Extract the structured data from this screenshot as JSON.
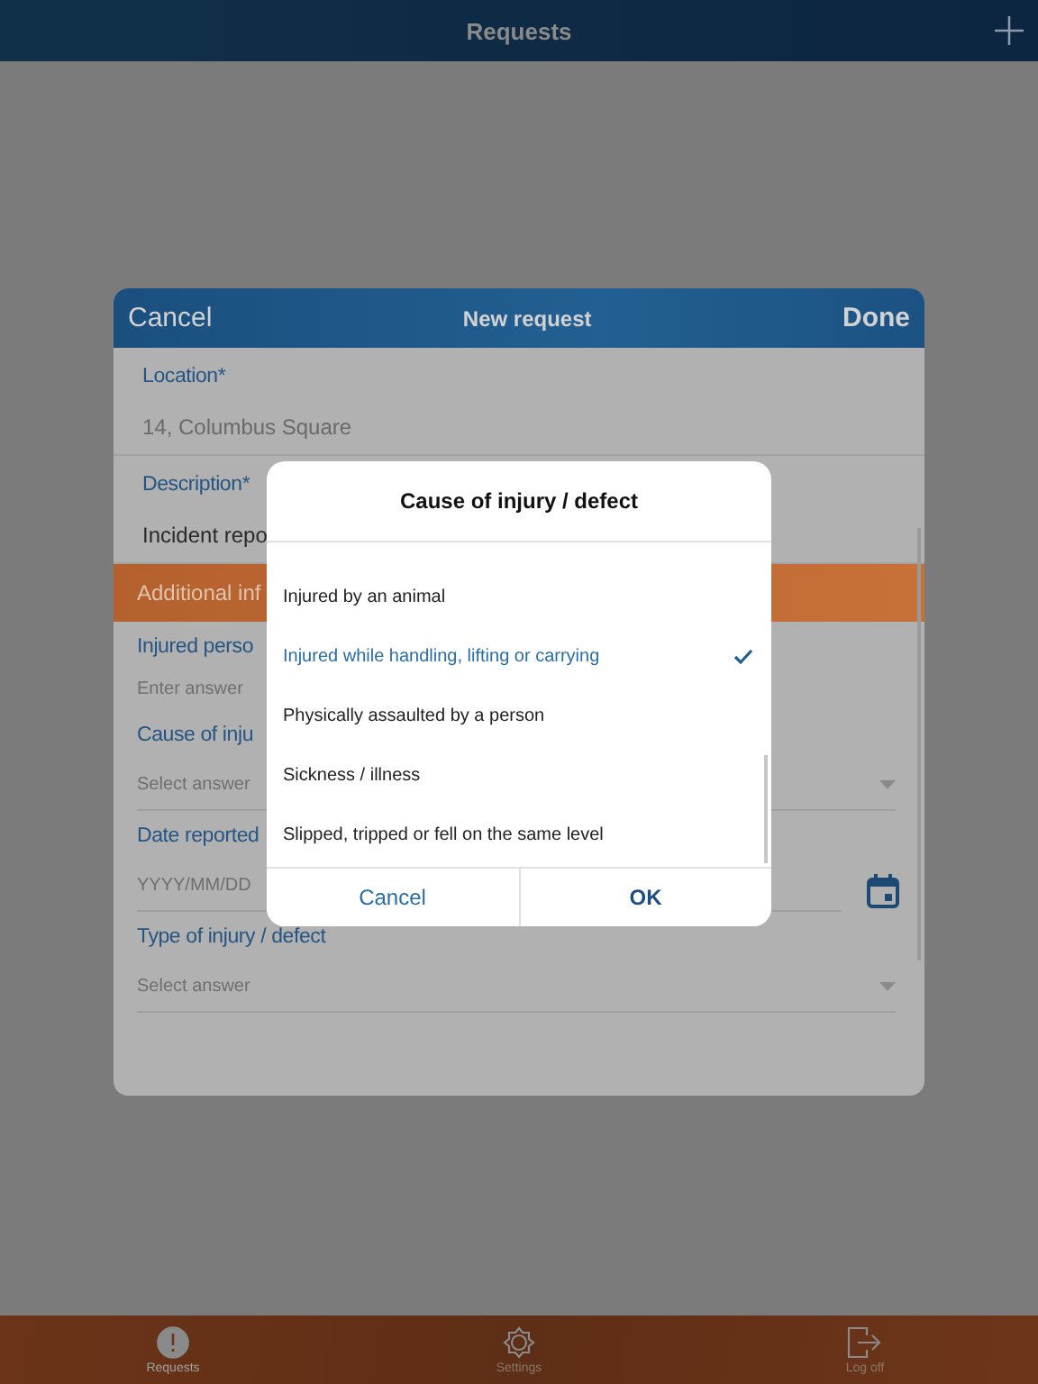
{
  "top_bar": {
    "title": "Requests"
  },
  "sheet": {
    "cancel": "Cancel",
    "title": "New request",
    "done": "Done",
    "fields": [
      {
        "kind": "text",
        "label": "Location*",
        "value": "14, Columbus Square"
      },
      {
        "kind": "text",
        "label": "Description*",
        "value": "Incident repo"
      },
      {
        "kind": "header",
        "label": "Additional inf"
      },
      {
        "kind": "input",
        "label": "Injured perso",
        "placeholder": "Enter answer"
      },
      {
        "kind": "select",
        "label": "Cause of inju",
        "placeholder": "Select answer"
      },
      {
        "kind": "date",
        "label": "Date reported",
        "placeholder": "YYYY/MM/DD"
      },
      {
        "kind": "select",
        "label": "Type of injury / defect",
        "placeholder": "Select answer"
      }
    ]
  },
  "dialog": {
    "title": "Cause of injury / defect",
    "options": [
      {
        "label": "Injured by an animal",
        "selected": false
      },
      {
        "label": "Injured while handling, lifting or carrying",
        "selected": true
      },
      {
        "label": "Physically assaulted by a person",
        "selected": false
      },
      {
        "label": "Sickness / illness",
        "selected": false
      },
      {
        "label": "Slipped, tripped or fell on the same level",
        "selected": false
      }
    ],
    "cancel": "Cancel",
    "ok": "OK"
  },
  "tabs": [
    {
      "kind": "alert",
      "label": "Requests",
      "selected": true
    },
    {
      "kind": "gear",
      "label": "Settings",
      "selected": false
    },
    {
      "kind": "logout",
      "label": "Log off",
      "selected": false
    }
  ]
}
